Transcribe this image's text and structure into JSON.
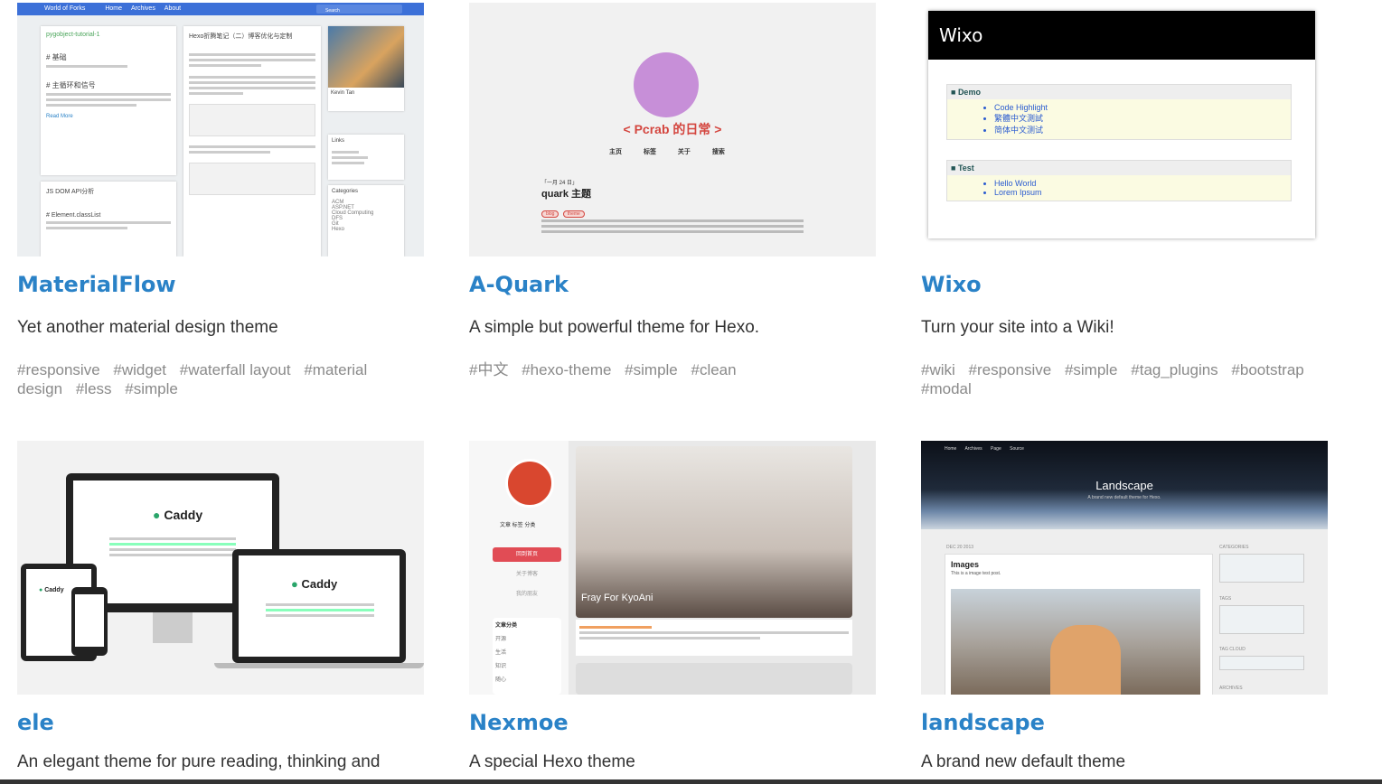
{
  "themes": [
    {
      "name": "MaterialFlow",
      "description": "Yet another material design theme",
      "tags": [
        "#responsive",
        "#widget",
        "#waterfall layout",
        "#material design",
        "#less",
        "#simple"
      ]
    },
    {
      "name": "A-Quark",
      "description": "A simple but powerful theme for Hexo.",
      "tags": [
        "#中文",
        "#hexo-theme",
        "#simple",
        "#clean"
      ]
    },
    {
      "name": "Wixo",
      "description": "Turn your site into a Wiki!",
      "tags": [
        "#wiki",
        "#responsive",
        "#simple",
        "#tag_plugins",
        "#bootstrap",
        "#modal"
      ]
    },
    {
      "name": "ele",
      "description": "An elegant theme for pure reading, thinking and"
    },
    {
      "name": "Nexmoe",
      "description": "A special Hexo theme"
    },
    {
      "name": "landscape",
      "description": "A brand new default theme"
    }
  ],
  "previews": {
    "materialflow": {
      "site": "World of Forks",
      "nav": [
        "Home",
        "Archives",
        "About"
      ],
      "search": "Search",
      "post1": "pygobject-tutorial-1",
      "post1_h1": "# 基础",
      "post1_h2": "# 主循环和信号",
      "post1_more": "Read More",
      "post2": "Hexo折腾笔记（二）博客优化与定制",
      "post3": "JS DOM API分析",
      "post3_h": "# Element.classList",
      "author": "Kevin Tan",
      "links_title": "Links",
      "categories_title": "Categories",
      "categories": [
        "ACM",
        "ASP.NET",
        "Cloud Computing",
        "DFS",
        "Git",
        "Hexo"
      ]
    },
    "quark": {
      "title": "< Pcrab 的日常 >",
      "nav": "主页 标签 关于 搜索",
      "date": "「一月 24 日」",
      "post_title": "quark 主题",
      "tags": [
        "blog",
        "theme"
      ]
    },
    "wixo": {
      "brand": "Wixo",
      "box1_title": "Demo",
      "box1_items": [
        "Code Highlight",
        "繁體中文測試",
        "简体中文测试"
      ],
      "box2_title": "Test",
      "box2_items": [
        "Hello World",
        "Lorem Ipsum"
      ]
    },
    "ele": {
      "logo": "Caddy"
    },
    "nexmoe": {
      "stats": "文章 标签 分类",
      "menu": [
        "回到首页",
        "关于博客",
        "我的朋友"
      ],
      "side_title": "文章分类",
      "side_items": [
        "开源",
        "生活",
        "知识",
        "随心"
      ],
      "caption": "Fray For KyoAni"
    },
    "landscape": {
      "nav": [
        "Home",
        "Archives",
        "Page",
        "Source"
      ],
      "title": "Landscape",
      "subtitle": "A brand new default theme for Hexo.",
      "date": "DEC 20 2013",
      "post_title": "Images",
      "post_sub": "This is a image test post.",
      "widgets": [
        "CATEGORIES",
        "TAGS",
        "TAG CLOUD",
        "ARCHIVES"
      ]
    }
  }
}
